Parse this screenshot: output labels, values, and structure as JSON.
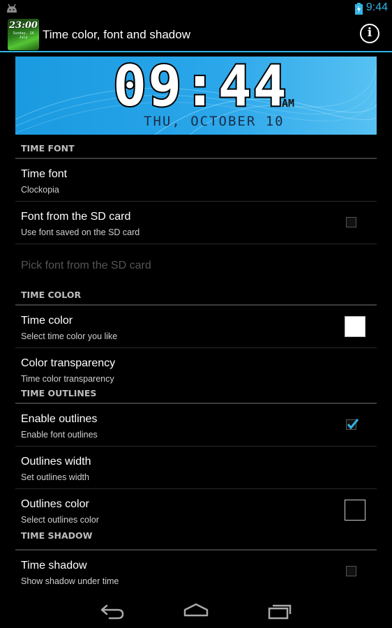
{
  "status_bar": {
    "time": "9:44",
    "accent_color": "#33b5e5",
    "left_icon": "android-icon",
    "battery_icon": "battery-charging-icon"
  },
  "action_bar": {
    "title": "Time color, font and shadow",
    "app_icon": {
      "time": "23:00",
      "date": "Sunday, 14 July"
    },
    "info_icon": "info-icon",
    "info_glyph": "i"
  },
  "preview": {
    "time": "09:44",
    "ampm": "AM",
    "date": "THU, OCTOBER 10",
    "background_color": "#2aa6ea"
  },
  "sections": {
    "time_font": {
      "header": "TIME FONT",
      "time_font": {
        "title": "Time font",
        "summary": "Clockopia"
      },
      "font_sd": {
        "title": "Font from the SD card",
        "summary": "Use font saved on the SD card",
        "checked": false
      },
      "pick_font": {
        "title": "Pick font from the SD card",
        "enabled": false
      }
    },
    "time_color": {
      "header": "TIME COLOR",
      "time_color": {
        "title": "Time color",
        "summary": "Select time color you like",
        "swatch": "#ffffff"
      },
      "transparency": {
        "title": "Color transparency",
        "summary": "Time color transparency"
      }
    },
    "time_outlines": {
      "header": "TIME OUTLINES",
      "enable": {
        "title": "Enable outlines",
        "summary": "Enable font outlines",
        "checked": true
      },
      "width": {
        "title": "Outlines width",
        "summary": "Set outlines width"
      },
      "color": {
        "title": "Outlines color",
        "summary": "Select outlines color",
        "swatch": "#000000"
      }
    },
    "time_shadow": {
      "header": "TIME SHADOW",
      "shadow": {
        "title": "Time shadow",
        "summary": "Show shadow under time",
        "checked": false
      }
    }
  },
  "nav_bar": {
    "back_icon": "back-icon",
    "home_icon": "home-icon",
    "recents_icon": "recents-icon"
  }
}
